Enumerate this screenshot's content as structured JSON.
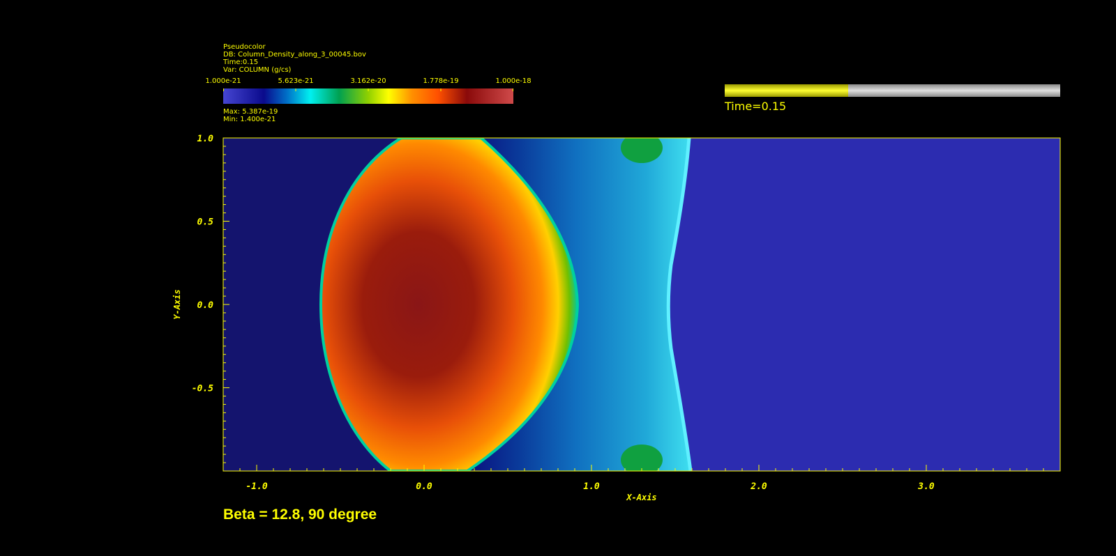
{
  "legend": {
    "plot_type": "Pseudocolor",
    "db": "DB: Column_Density_along_3_00045.bov",
    "time": "Time:0.15",
    "var": "Var: COLUMN (g/cs)",
    "max": "Max:  5.387e-19",
    "min": "Min:  1.400e-21",
    "colorbar_labels": [
      "1.000e-21",
      "5.623e-21",
      "3.162e-20",
      "1.778e-19",
      "1.000e-18"
    ]
  },
  "time_slider": {
    "label": "Time=0.15",
    "progress": 0.367
  },
  "caption": "Beta = 12.8, 90 degree",
  "chart_data": {
    "type": "heatmap",
    "title": "",
    "xlabel": "X-Axis",
    "ylabel": "Y-Axis",
    "xlim": [
      -1.2,
      3.8
    ],
    "ylim": [
      -1.0,
      1.0
    ],
    "x_ticks": [
      "-1.0",
      "0.0",
      "1.0",
      "2.0",
      "3.0"
    ],
    "x_tick_values": [
      -1.0,
      0.0,
      1.0,
      2.0,
      3.0
    ],
    "y_ticks": [
      "1.0",
      "0.5",
      "0.0",
      "-0.5"
    ],
    "y_tick_values": [
      1.0,
      0.5,
      0.0,
      -0.5
    ],
    "colorscale": "log",
    "color_range": [
      1e-21,
      1e-18
    ],
    "colors": {
      "background_region": "#14146e",
      "downstream_region": "#2c2cb0",
      "dense_core": "#8a1414",
      "axis": "#ffff00"
    }
  }
}
